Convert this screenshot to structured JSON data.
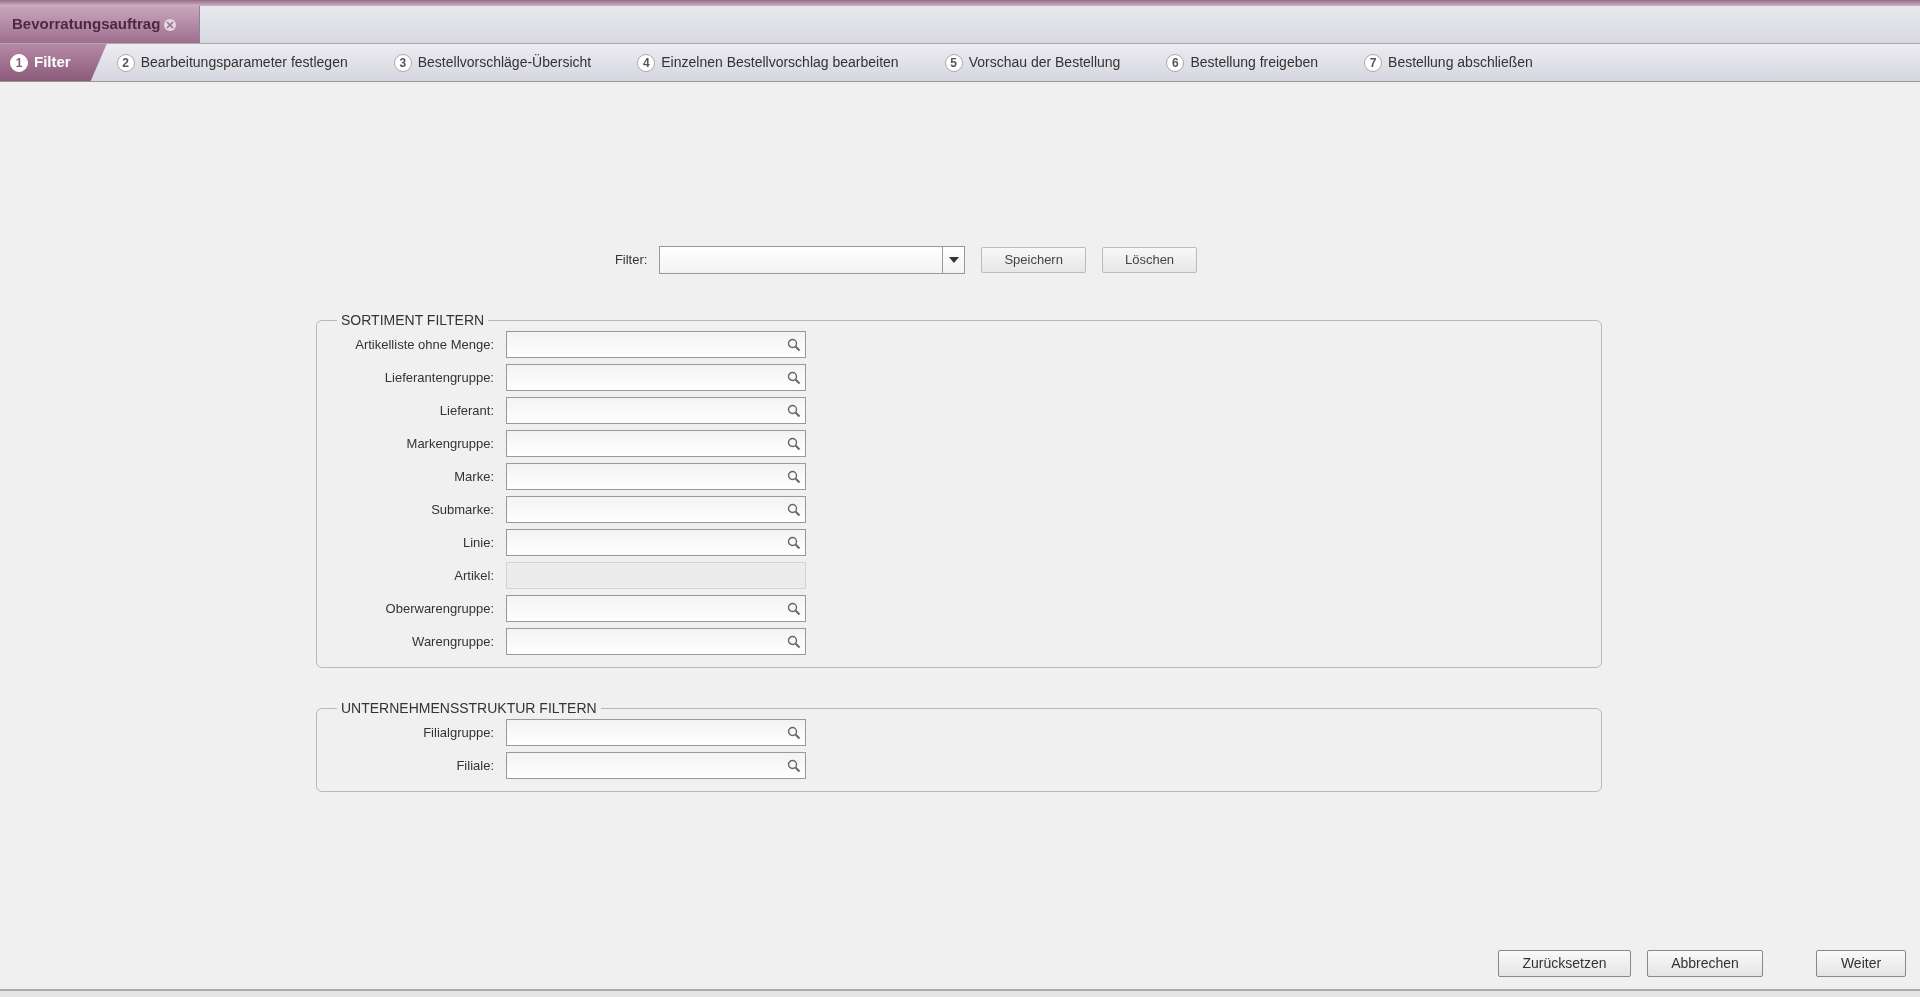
{
  "document_tab": {
    "title": "Bevorratungsauftrag",
    "selected": true
  },
  "steps": [
    {
      "number": "1",
      "label": "Filter",
      "selected": true
    },
    {
      "number": "2",
      "label": "Bearbeitungsparameter festlegen",
      "selected": false
    },
    {
      "number": "3",
      "label": "Bestellvorschläge-Übersicht",
      "selected": false
    },
    {
      "number": "4",
      "label": "Einzelnen Bestellvorschlag bearbeiten",
      "selected": false
    },
    {
      "number": "5",
      "label": "Vorschau der Bestellung",
      "selected": false
    },
    {
      "number": "6",
      "label": "Bestellung freigeben",
      "selected": false
    },
    {
      "number": "7",
      "label": "Bestellung abschließen",
      "selected": false
    }
  ],
  "filter_bar": {
    "label": "Filter:",
    "buttons": [
      "Speichern",
      "Löschen"
    ]
  },
  "groups": [
    {
      "title": "SORTIMENT FILTERN",
      "fields": [
        {
          "label": "Artikelliste ohne Menge:",
          "disabled": false
        },
        {
          "label": "Lieferantengruppe:",
          "disabled": false
        },
        {
          "label": "Lieferant:",
          "disabled": false
        },
        {
          "label": "Markengruppe:",
          "disabled": false
        },
        {
          "label": "Marke:",
          "disabled": false
        },
        {
          "label": "Submarke:",
          "disabled": false
        },
        {
          "label": "Linie:",
          "disabled": false
        },
        {
          "label": "Artikel:",
          "disabled": true
        },
        {
          "label": "Oberwarengruppe:",
          "disabled": false
        },
        {
          "label": "Warengruppe:",
          "disabled": false
        }
      ]
    },
    {
      "title": "UNTERNEHMENSSTRUKTUR FILTERN",
      "fields": [
        {
          "label": "Filialgruppe:",
          "disabled": false
        },
        {
          "label": "Filiale:",
          "disabled": false
        }
      ]
    }
  ],
  "footer_buttons": [
    "Zurücksetzen",
    "Abbrechen",
    "Weiter"
  ]
}
